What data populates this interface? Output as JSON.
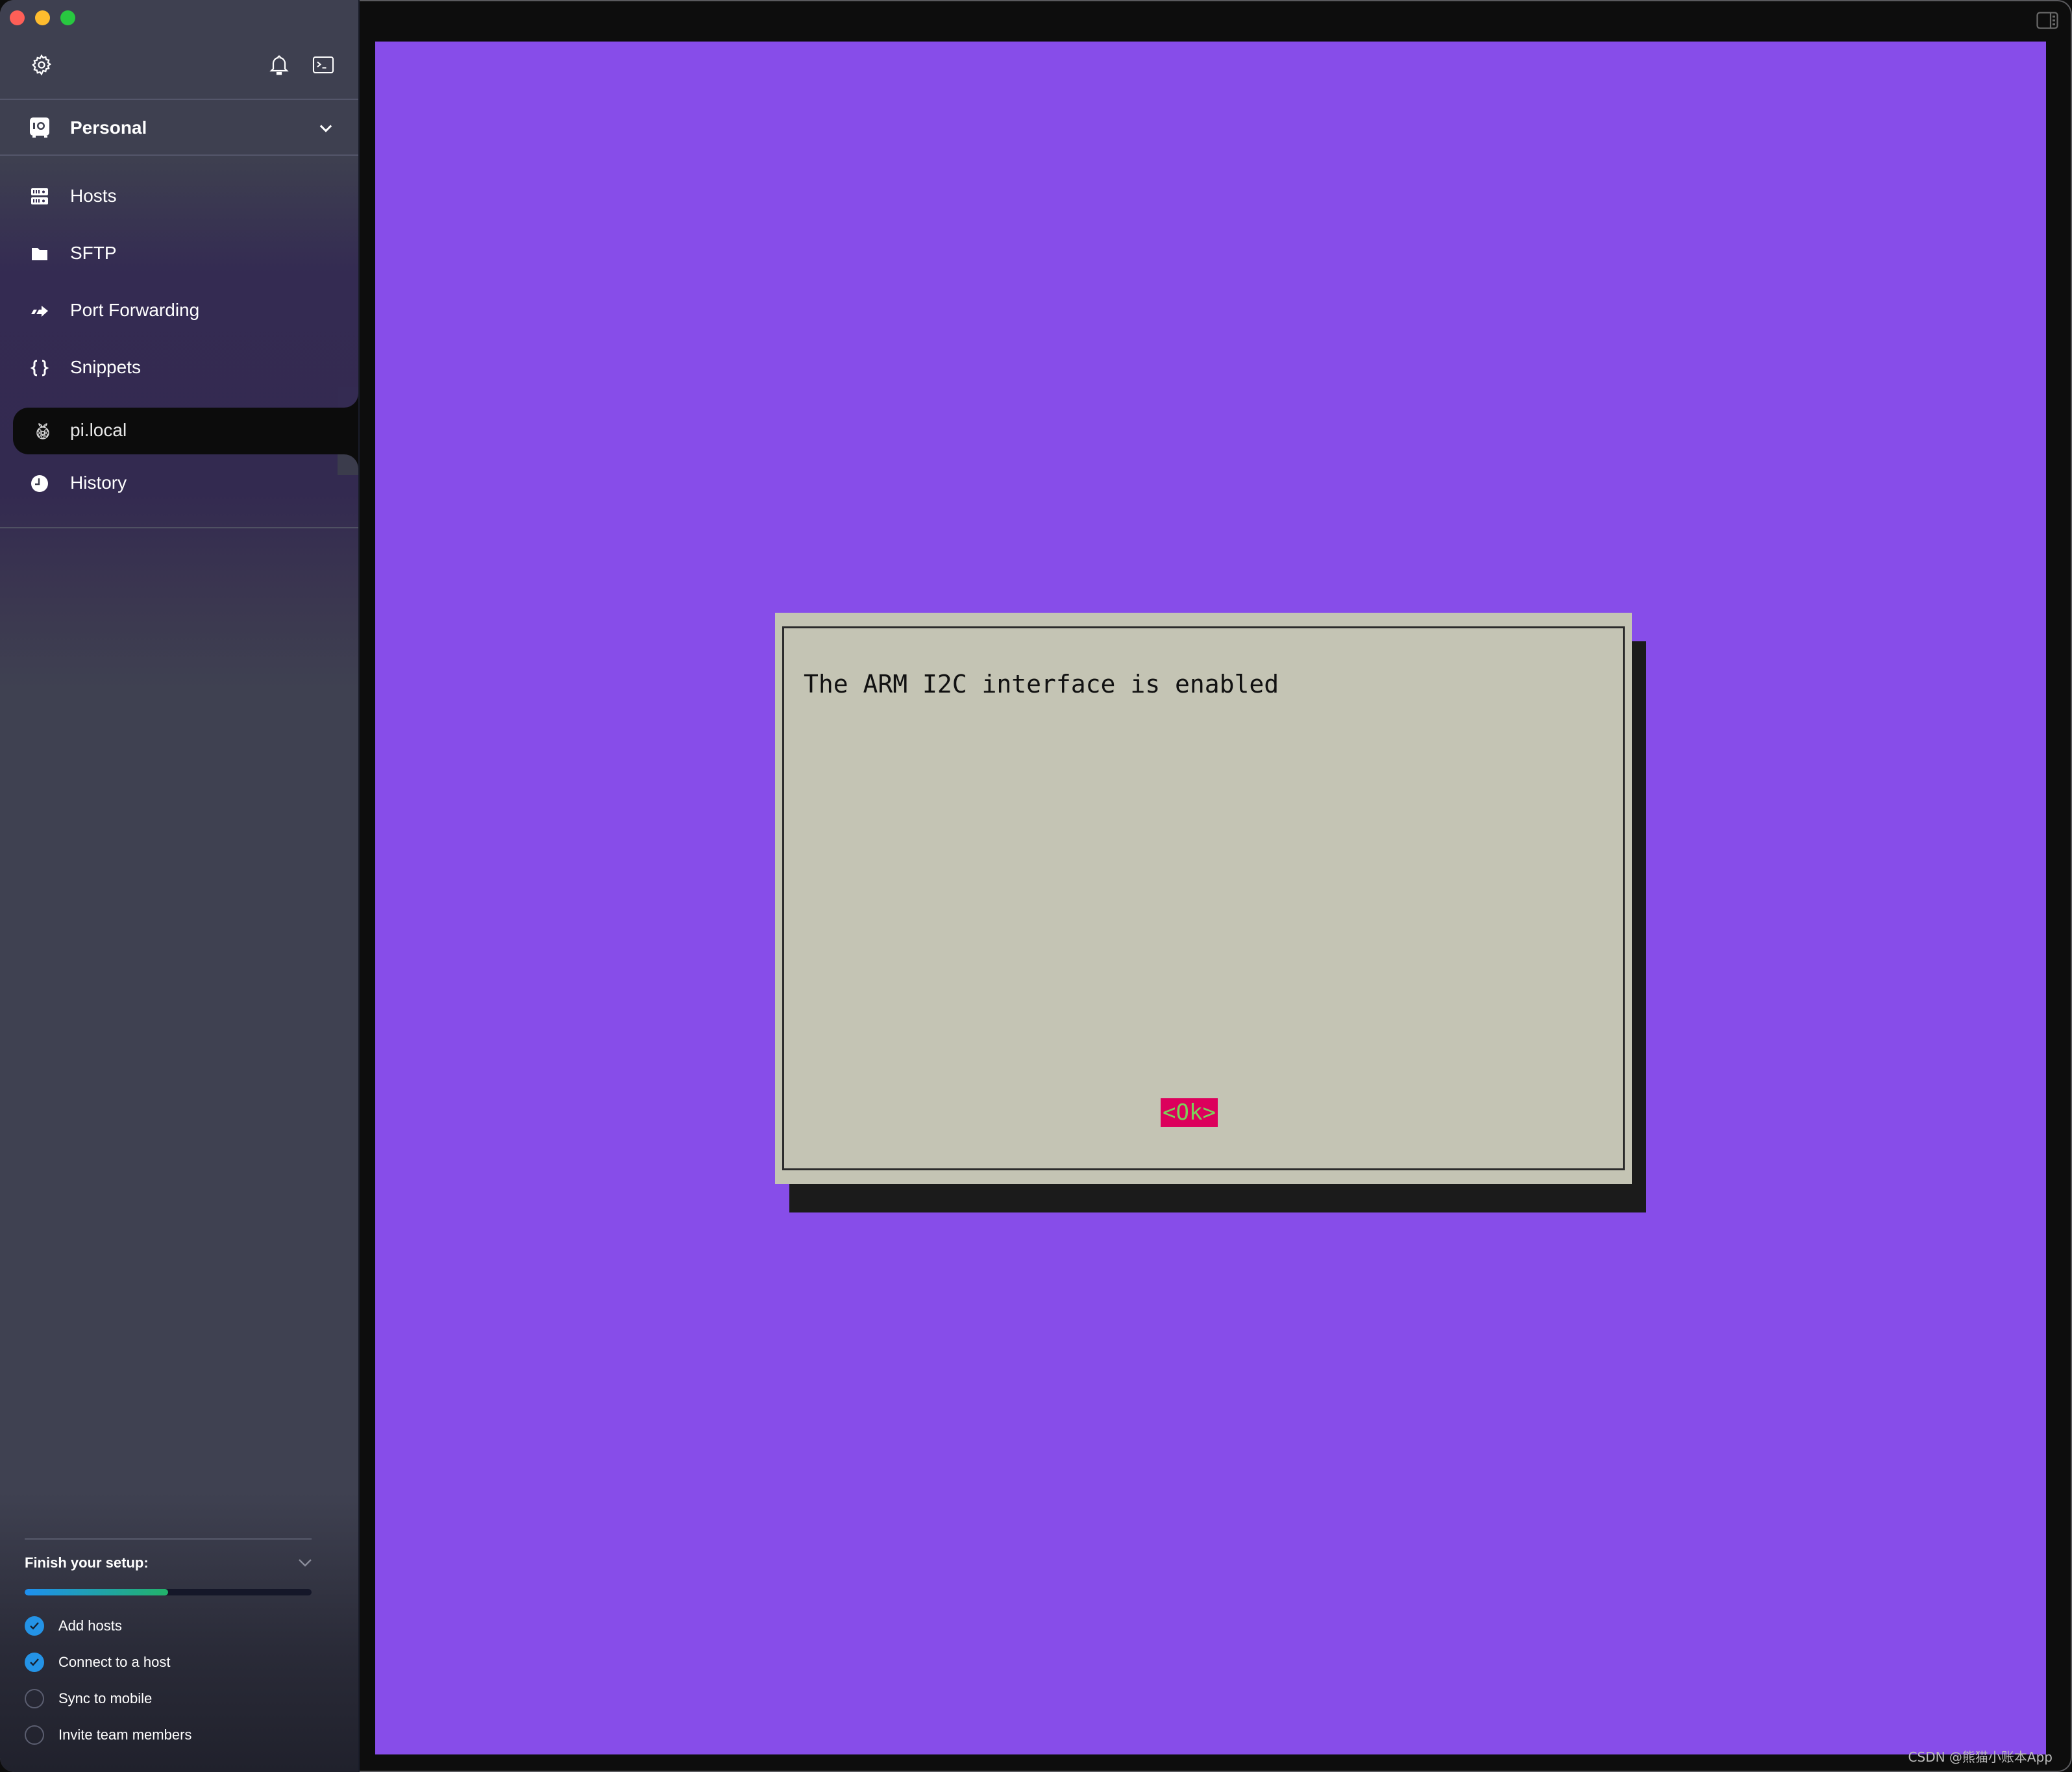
{
  "window": {
    "traffic_lights": [
      "close",
      "minimize",
      "maximize"
    ]
  },
  "sidebar": {
    "top_icons": [
      "gear-icon",
      "bell-icon",
      "terminal-icon"
    ],
    "vault": {
      "label": "Personal",
      "icon": "vault-icon"
    },
    "nav": [
      {
        "label": "Hosts",
        "icon": "server-icon"
      },
      {
        "label": "SFTP",
        "icon": "folder-icon"
      },
      {
        "label": "Port Forwarding",
        "icon": "forward-arrow-icon"
      },
      {
        "label": "Snippets",
        "icon": "braces-icon"
      }
    ],
    "active_tab": {
      "label": "pi.local",
      "icon": "raspberry-pi-icon"
    },
    "history": {
      "label": "History",
      "icon": "clock-icon"
    },
    "setup": {
      "title": "Finish your setup:",
      "progress_percent": 50,
      "progress_colors": [
        "#1e8ff0",
        "#22b36a"
      ],
      "items": [
        {
          "label": "Add hosts",
          "done": true
        },
        {
          "label": "Connect to a host",
          "done": true
        },
        {
          "label": "Sync to mobile",
          "done": false
        },
        {
          "label": "Invite team members",
          "done": false
        }
      ]
    }
  },
  "terminal": {
    "background": "#874de9",
    "dialog": {
      "message": "The ARM I2C interface is enabled",
      "ok_label": "<Ok>"
    }
  },
  "watermark": "CSDN @熊猫小账本App"
}
